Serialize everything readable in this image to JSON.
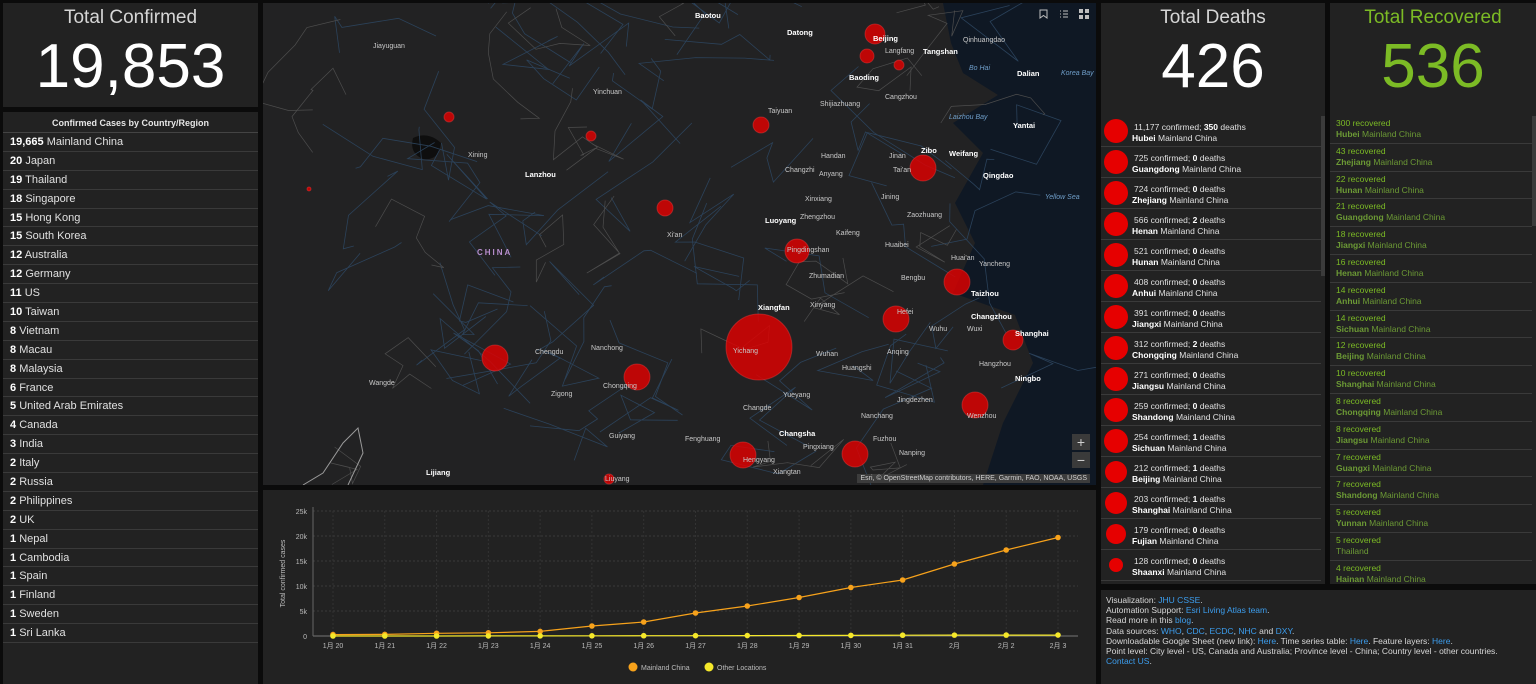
{
  "confirmed": {
    "title": "Total Confirmed",
    "value": "19,853"
  },
  "country_list": {
    "title": "Confirmed Cases by Country/Region",
    "items": [
      {
        "count": "19,665",
        "name": "Mainland China"
      },
      {
        "count": "20",
        "name": "Japan"
      },
      {
        "count": "19",
        "name": "Thailand"
      },
      {
        "count": "18",
        "name": "Singapore"
      },
      {
        "count": "15",
        "name": "Hong Kong"
      },
      {
        "count": "15",
        "name": "South Korea"
      },
      {
        "count": "12",
        "name": "Australia"
      },
      {
        "count": "12",
        "name": "Germany"
      },
      {
        "count": "11",
        "name": "US"
      },
      {
        "count": "10",
        "name": "Taiwan"
      },
      {
        "count": "8",
        "name": "Vietnam"
      },
      {
        "count": "8",
        "name": "Macau"
      },
      {
        "count": "8",
        "name": "Malaysia"
      },
      {
        "count": "6",
        "name": "France"
      },
      {
        "count": "5",
        "name": "United Arab Emirates"
      },
      {
        "count": "4",
        "name": "Canada"
      },
      {
        "count": "3",
        "name": "India"
      },
      {
        "count": "2",
        "name": "Italy"
      },
      {
        "count": "2",
        "name": "Russia"
      },
      {
        "count": "2",
        "name": "Philippines"
      },
      {
        "count": "2",
        "name": "UK"
      },
      {
        "count": "1",
        "name": "Nepal"
      },
      {
        "count": "1",
        "name": "Cambodia"
      },
      {
        "count": "1",
        "name": "Spain"
      },
      {
        "count": "1",
        "name": "Finland"
      },
      {
        "count": "1",
        "name": "Sweden"
      },
      {
        "count": "1",
        "name": "Sri Lanka"
      }
    ]
  },
  "map": {
    "attribution": "Esri, © OpenStreetMap contributors, HERE, Garmin, FAO, NOAA, USGS",
    "zoom_in": "+",
    "zoom_out": "−",
    "tools": [
      "bookmark-icon",
      "list-icon",
      "grid-icon"
    ],
    "labels": [
      {
        "t": "Baotou",
        "x": 432,
        "y": 8,
        "s": 1
      },
      {
        "t": "Datong",
        "x": 524,
        "y": 25,
        "s": 1
      },
      {
        "t": "Beijing",
        "x": 610,
        "y": 31,
        "s": 1
      },
      {
        "t": "Langfang",
        "x": 622,
        "y": 45,
        "s": 0
      },
      {
        "t": "Tangshan",
        "x": 660,
        "y": 44,
        "s": 1
      },
      {
        "t": "Qinhuangdao",
        "x": 700,
        "y": 34,
        "s": 0
      },
      {
        "t": "Baoding",
        "x": 586,
        "y": 70,
        "s": 1
      },
      {
        "t": "Cangzhou",
        "x": 622,
        "y": 91,
        "s": 0
      },
      {
        "t": "Taiyuan",
        "x": 505,
        "y": 105,
        "s": 0
      },
      {
        "t": "Shijiazhuang",
        "x": 557,
        "y": 98,
        "s": 0
      },
      {
        "t": "Dalian",
        "x": 754,
        "y": 66,
        "s": 1
      },
      {
        "t": "Yinchuan",
        "x": 330,
        "y": 86,
        "s": 0
      },
      {
        "t": "Jiayuguan",
        "x": 110,
        "y": 40,
        "s": 0
      },
      {
        "t": "Yantai",
        "x": 750,
        "y": 118,
        "s": 1
      },
      {
        "t": "Zibo",
        "x": 658,
        "y": 143,
        "s": 1
      },
      {
        "t": "Weifang",
        "x": 686,
        "y": 146,
        "s": 1
      },
      {
        "t": "Jinan",
        "x": 626,
        "y": 150,
        "s": 0
      },
      {
        "t": "Handan",
        "x": 558,
        "y": 150,
        "s": 0
      },
      {
        "t": "Changzhi",
        "x": 522,
        "y": 164,
        "s": 0
      },
      {
        "t": "Anyang",
        "x": 556,
        "y": 168,
        "s": 0
      },
      {
        "t": "Tai'an",
        "x": 630,
        "y": 164,
        "s": 0
      },
      {
        "t": "Qingdao",
        "x": 720,
        "y": 168,
        "s": 1
      },
      {
        "t": "Xining",
        "x": 205,
        "y": 149,
        "s": 0
      },
      {
        "t": "Lanzhou",
        "x": 262,
        "y": 167,
        "s": 1
      },
      {
        "t": "Luoyang",
        "x": 502,
        "y": 213,
        "s": 1
      },
      {
        "t": "Zhengzhou",
        "x": 537,
        "y": 211,
        "s": 0
      },
      {
        "t": "Xinxiang",
        "x": 542,
        "y": 193,
        "s": 0
      },
      {
        "t": "Jining",
        "x": 618,
        "y": 191,
        "s": 0
      },
      {
        "t": "Zaozhuang",
        "x": 644,
        "y": 209,
        "s": 0
      },
      {
        "t": "Xi'an",
        "x": 404,
        "y": 229,
        "s": 0
      },
      {
        "t": "Kaifeng",
        "x": 573,
        "y": 227,
        "s": 0
      },
      {
        "t": "Huaibei",
        "x": 622,
        "y": 239,
        "s": 0
      },
      {
        "t": "CHINA",
        "x": 214,
        "y": 245,
        "s": 2
      },
      {
        "t": "Pingdingshan",
        "x": 524,
        "y": 244,
        "s": 0
      },
      {
        "t": "Huai'an",
        "x": 688,
        "y": 252,
        "s": 0
      },
      {
        "t": "Zhumadian",
        "x": 546,
        "y": 270,
        "s": 0
      },
      {
        "t": "Bengbu",
        "x": 638,
        "y": 272,
        "s": 0
      },
      {
        "t": "Yancheng",
        "x": 716,
        "y": 258,
        "s": 0
      },
      {
        "t": "Taizhou",
        "x": 708,
        "y": 286,
        "s": 1
      },
      {
        "t": "Xiangfan",
        "x": 495,
        "y": 300,
        "s": 1
      },
      {
        "t": "Xinyang",
        "x": 547,
        "y": 299,
        "s": 0
      },
      {
        "t": "Hefei",
        "x": 634,
        "y": 306,
        "s": 0
      },
      {
        "t": "Changzhou",
        "x": 708,
        "y": 309,
        "s": 1
      },
      {
        "t": "Wuhu",
        "x": 666,
        "y": 323,
        "s": 0
      },
      {
        "t": "Wuxi",
        "x": 704,
        "y": 323,
        "s": 0
      },
      {
        "t": "Shanghai",
        "x": 752,
        "y": 326,
        "s": 1
      },
      {
        "t": "Chengdu",
        "x": 272,
        "y": 346,
        "s": 0
      },
      {
        "t": "Nanchong",
        "x": 328,
        "y": 342,
        "s": 0
      },
      {
        "t": "Yichang",
        "x": 470,
        "y": 345,
        "s": 0
      },
      {
        "t": "Wuhan",
        "x": 553,
        "y": 348,
        "s": 0
      },
      {
        "t": "Anqing",
        "x": 624,
        "y": 346,
        "s": 0
      },
      {
        "t": "Hangzhou",
        "x": 716,
        "y": 358,
        "s": 0
      },
      {
        "t": "Huangshi",
        "x": 579,
        "y": 362,
        "s": 0
      },
      {
        "t": "Chongqing",
        "x": 340,
        "y": 380,
        "s": 0
      },
      {
        "t": "Ningbo",
        "x": 752,
        "y": 371,
        "s": 1
      },
      {
        "t": "Wangde",
        "x": 106,
        "y": 377,
        "s": 0
      },
      {
        "t": "Zigong",
        "x": 288,
        "y": 388,
        "s": 0
      },
      {
        "t": "Yueyang",
        "x": 520,
        "y": 389,
        "s": 0
      },
      {
        "t": "Jingdezhen",
        "x": 634,
        "y": 394,
        "s": 0
      },
      {
        "t": "Changde",
        "x": 480,
        "y": 402,
        "s": 0
      },
      {
        "t": "Nanchang",
        "x": 598,
        "y": 410,
        "s": 0
      },
      {
        "t": "Wenzhou",
        "x": 704,
        "y": 410,
        "s": 0
      },
      {
        "t": "Changsha",
        "x": 516,
        "y": 426,
        "s": 1
      },
      {
        "t": "Fuzhou",
        "x": 610,
        "y": 433,
        "s": 0
      },
      {
        "t": "Guiyang",
        "x": 346,
        "y": 430,
        "s": 0
      },
      {
        "t": "Fenghuang",
        "x": 422,
        "y": 433,
        "s": 0
      },
      {
        "t": "Pingxiang",
        "x": 540,
        "y": 441,
        "s": 0
      },
      {
        "t": "Nanping",
        "x": 636,
        "y": 447,
        "s": 0
      },
      {
        "t": "Hengyang",
        "x": 480,
        "y": 454,
        "s": 0
      },
      {
        "t": "Xiangtan",
        "x": 510,
        "y": 466,
        "s": 0
      },
      {
        "t": "Lijiang",
        "x": 163,
        "y": 465,
        "s": 1
      },
      {
        "t": "Liuyang",
        "x": 342,
        "y": 473,
        "s": 0
      }
    ],
    "water": [
      {
        "t": "Bo Hai",
        "x": 706,
        "y": 62
      },
      {
        "t": "Korea Bay",
        "x": 798,
        "y": 67
      },
      {
        "t": "Laizhou Bay",
        "x": 686,
        "y": 111
      },
      {
        "t": "Yellow Sea",
        "x": 782,
        "y": 191
      }
    ],
    "bubbles": [
      {
        "x": 496,
        "y": 344,
        "r": 33
      },
      {
        "x": 612,
        "y": 31,
        "r": 10
      },
      {
        "x": 604,
        "y": 53,
        "r": 7
      },
      {
        "x": 636,
        "y": 62,
        "r": 5
      },
      {
        "x": 660,
        "y": 165,
        "r": 13
      },
      {
        "x": 498,
        "y": 122,
        "r": 8
      },
      {
        "x": 402,
        "y": 205,
        "r": 8
      },
      {
        "x": 534,
        "y": 248,
        "r": 12
      },
      {
        "x": 694,
        "y": 279,
        "r": 13
      },
      {
        "x": 633,
        "y": 316,
        "r": 13
      },
      {
        "x": 750,
        "y": 337,
        "r": 10
      },
      {
        "x": 232,
        "y": 355,
        "r": 13
      },
      {
        "x": 374,
        "y": 374,
        "r": 13
      },
      {
        "x": 712,
        "y": 402,
        "r": 13
      },
      {
        "x": 480,
        "y": 452,
        "r": 13
      },
      {
        "x": 592,
        "y": 451,
        "r": 13
      },
      {
        "x": 186,
        "y": 114,
        "r": 5
      },
      {
        "x": 328,
        "y": 133,
        "r": 5
      },
      {
        "x": 346,
        "y": 476,
        "r": 5
      },
      {
        "x": 46,
        "y": 186,
        "r": 2
      }
    ]
  },
  "chart_data": {
    "type": "line",
    "title": "",
    "xlabel": "",
    "ylabel": "Total confirmed cases",
    "categories": [
      "1月 20",
      "1月 21",
      "1月 22",
      "1月 23",
      "1月 24",
      "1月 25",
      "1月 26",
      "1月 27",
      "1月 28",
      "1月 29",
      "1月 30",
      "1月 31",
      "2月",
      "2月 2",
      "2月 3"
    ],
    "y_ticks": [
      "0",
      "5k",
      "10k",
      "15k",
      "20k",
      "25k"
    ],
    "ylim": [
      0,
      25000
    ],
    "grid": true,
    "legend": "bottom",
    "series": [
      {
        "name": "Mainland China",
        "color": "#f7a21b",
        "values": [
          278,
          326,
          547,
          639,
          916,
          2000,
          2800,
          4600,
          6000,
          7700,
          9700,
          11200,
          14400,
          17200,
          19700
        ]
      },
      {
        "name": "Other Locations",
        "color": "#f5e82a",
        "values": [
          4,
          6,
          8,
          14,
          25,
          40,
          57,
          64,
          87,
          105,
          118,
          153,
          173,
          183,
          188
        ]
      }
    ]
  },
  "deaths": {
    "title": "Total Deaths",
    "value": "426",
    "confirmed_word": "confirmed;",
    "deaths_word": "deaths",
    "items": [
      {
        "confirmed": "11,177",
        "deaths": "350",
        "province": "Hubei",
        "region": "Mainland China",
        "r": 12
      },
      {
        "confirmed": "725",
        "deaths": "0",
        "province": "Guangdong",
        "region": "Mainland China",
        "r": 12
      },
      {
        "confirmed": "724",
        "deaths": "0",
        "province": "Zhejiang",
        "region": "Mainland China",
        "r": 12
      },
      {
        "confirmed": "566",
        "deaths": "2",
        "province": "Henan",
        "region": "Mainland China",
        "r": 12
      },
      {
        "confirmed": "521",
        "deaths": "0",
        "province": "Hunan",
        "region": "Mainland China",
        "r": 12
      },
      {
        "confirmed": "408",
        "deaths": "0",
        "province": "Anhui",
        "region": "Mainland China",
        "r": 12
      },
      {
        "confirmed": "391",
        "deaths": "0",
        "province": "Jiangxi",
        "region": "Mainland China",
        "r": 12
      },
      {
        "confirmed": "312",
        "deaths": "2",
        "province": "Chongqing",
        "region": "Mainland China",
        "r": 12
      },
      {
        "confirmed": "271",
        "deaths": "0",
        "province": "Jiangsu",
        "region": "Mainland China",
        "r": 12
      },
      {
        "confirmed": "259",
        "deaths": "0",
        "province": "Shandong",
        "region": "Mainland China",
        "r": 12
      },
      {
        "confirmed": "254",
        "deaths": "1",
        "province": "Sichuan",
        "region": "Mainland China",
        "r": 12
      },
      {
        "confirmed": "212",
        "deaths": "1",
        "province": "Beijing",
        "region": "Mainland China",
        "r": 11
      },
      {
        "confirmed": "203",
        "deaths": "1",
        "province": "Shanghai",
        "region": "Mainland China",
        "r": 11
      },
      {
        "confirmed": "179",
        "deaths": "0",
        "province": "Fujian",
        "region": "Mainland China",
        "r": 10
      },
      {
        "confirmed": "128",
        "deaths": "0",
        "province": "Shaanxi",
        "region": "Mainland China",
        "r": 7
      }
    ]
  },
  "recovered": {
    "title": "Total Recovered",
    "value": "536",
    "word": "recovered",
    "items": [
      {
        "count": "300",
        "province": "Hubei",
        "region": "Mainland China"
      },
      {
        "count": "43",
        "province": "Zhejiang",
        "region": "Mainland China"
      },
      {
        "count": "22",
        "province": "Hunan",
        "region": "Mainland China"
      },
      {
        "count": "21",
        "province": "Guangdong",
        "region": "Mainland China"
      },
      {
        "count": "18",
        "province": "Jiangxi",
        "region": "Mainland China"
      },
      {
        "count": "16",
        "province": "Henan",
        "region": "Mainland China"
      },
      {
        "count": "14",
        "province": "Anhui",
        "region": "Mainland China"
      },
      {
        "count": "14",
        "province": "Sichuan",
        "region": "Mainland China"
      },
      {
        "count": "12",
        "province": "Beijing",
        "region": "Mainland China"
      },
      {
        "count": "10",
        "province": "Shanghai",
        "region": "Mainland China"
      },
      {
        "count": "8",
        "province": "Chongqing",
        "region": "Mainland China"
      },
      {
        "count": "8",
        "province": "Jiangsu",
        "region": "Mainland China"
      },
      {
        "count": "7",
        "province": "Guangxi",
        "region": "Mainland China"
      },
      {
        "count": "7",
        "province": "Shandong",
        "region": "Mainland China"
      },
      {
        "count": "5",
        "province": "Yunnan",
        "region": "Mainland China"
      },
      {
        "count": "5",
        "province": "",
        "region": "Thailand"
      },
      {
        "count": "4",
        "province": "Hainan",
        "region": "Mainland China"
      }
    ]
  },
  "info": {
    "line1_a": "Visualization: ",
    "line1_link": "JHU CSSE",
    "line1_b": ".",
    "line2_a": "Automation Support: ",
    "line2_link": "Esri Living Atlas team",
    "line2_b": ".",
    "line3_a": "Read more in this ",
    "line3_link": "blog",
    "line3_b": ".",
    "line4_a": "Data sources: ",
    "src1": "WHO",
    "src2": "CDC",
    "src3": "ECDC",
    "src4": "NHC",
    "and": " and ",
    "src5": "DXY",
    "line4_b": ".",
    "line5_a": "Downloadable Google Sheet (new link): ",
    "line5_link1": "Here",
    "line5_b": ". Time series table: ",
    "line5_link2": "Here",
    "line5_c": ". Feature layers: ",
    "line5_link3": "Here",
    "line5_d": ".",
    "line6": "Point level: City level - US, Canada and Australia; Province level - China; Country level - other countries.",
    "line7_link": "Contact US",
    "line7_b": "."
  }
}
